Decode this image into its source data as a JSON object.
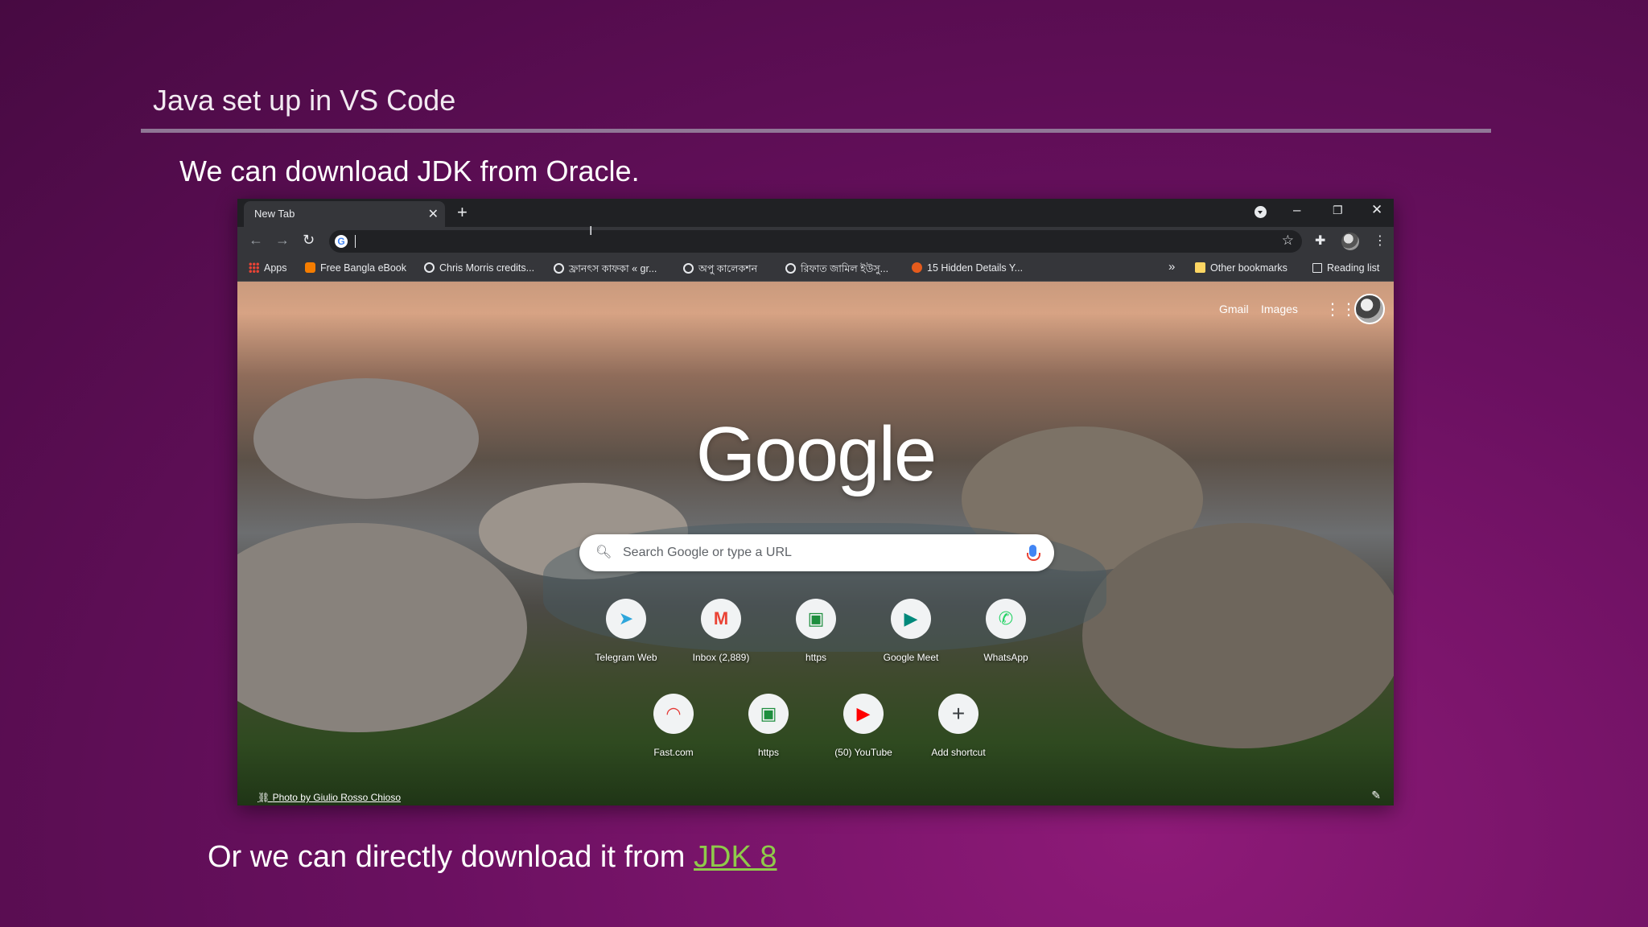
{
  "slide": {
    "title": "Java set up in VS Code",
    "subtitle": "We can download JDK from Oracle.",
    "bottom_prefix": "Or we can directly download it from ",
    "bottom_link": "JDK 8"
  },
  "browser": {
    "tab_title": "New Tab",
    "omnibox_value": "",
    "bookmarks": [
      {
        "label": "Apps",
        "icon": "apps-icon"
      },
      {
        "label": "Free Bangla eBook",
        "icon": "blogger-icon"
      },
      {
        "label": "Chris Morris credits...",
        "icon": "globe-icon"
      },
      {
        "label": "ফ্রানৎস কাফকা « gr...",
        "icon": "globe-icon"
      },
      {
        "label": "অপু কালেকশন",
        "icon": "globe-icon"
      },
      {
        "label": "রিফাত জামিল ইউসু...",
        "icon": "globe-icon"
      },
      {
        "label": "15 Hidden Details Y...",
        "icon": "site-icon"
      }
    ],
    "bookmarks_overflow": "»",
    "other_bookmarks": "Other bookmarks",
    "reading_list": "Reading list"
  },
  "ntp": {
    "gmail": "Gmail",
    "images": "Images",
    "logo": "Google",
    "search_placeholder": "Search Google or type a URL",
    "shortcuts_row1": [
      {
        "label": "Telegram Web",
        "icon": "telegram-icon",
        "glyph": "➤",
        "color": "#2ea6db"
      },
      {
        "label": "Inbox (2,889)",
        "icon": "gmail-icon",
        "glyph": "M",
        "color": "#ea4335"
      },
      {
        "label": "https",
        "icon": "classroom-icon",
        "glyph": "▣",
        "color": "#1e8e3e"
      },
      {
        "label": "Google Meet",
        "icon": "meet-icon",
        "glyph": "▶",
        "color": "#00897b"
      },
      {
        "label": "WhatsApp",
        "icon": "whatsapp-icon",
        "glyph": "✆",
        "color": "#25d366"
      }
    ],
    "shortcuts_row2": [
      {
        "label": "Fast.com",
        "icon": "speedometer-icon",
        "glyph": "◠",
        "color": "#e53935"
      },
      {
        "label": "https",
        "icon": "classroom-icon",
        "glyph": "▣",
        "color": "#1e8e3e"
      },
      {
        "label": "(50) YouTube",
        "icon": "youtube-icon",
        "glyph": "▶",
        "color": "#ff0000"
      },
      {
        "label": "Add shortcut",
        "icon": "plus-icon",
        "glyph": "+",
        "color": "#3c4043"
      }
    ],
    "photo_credit": "Photo by Giulio Rosso Chioso"
  }
}
